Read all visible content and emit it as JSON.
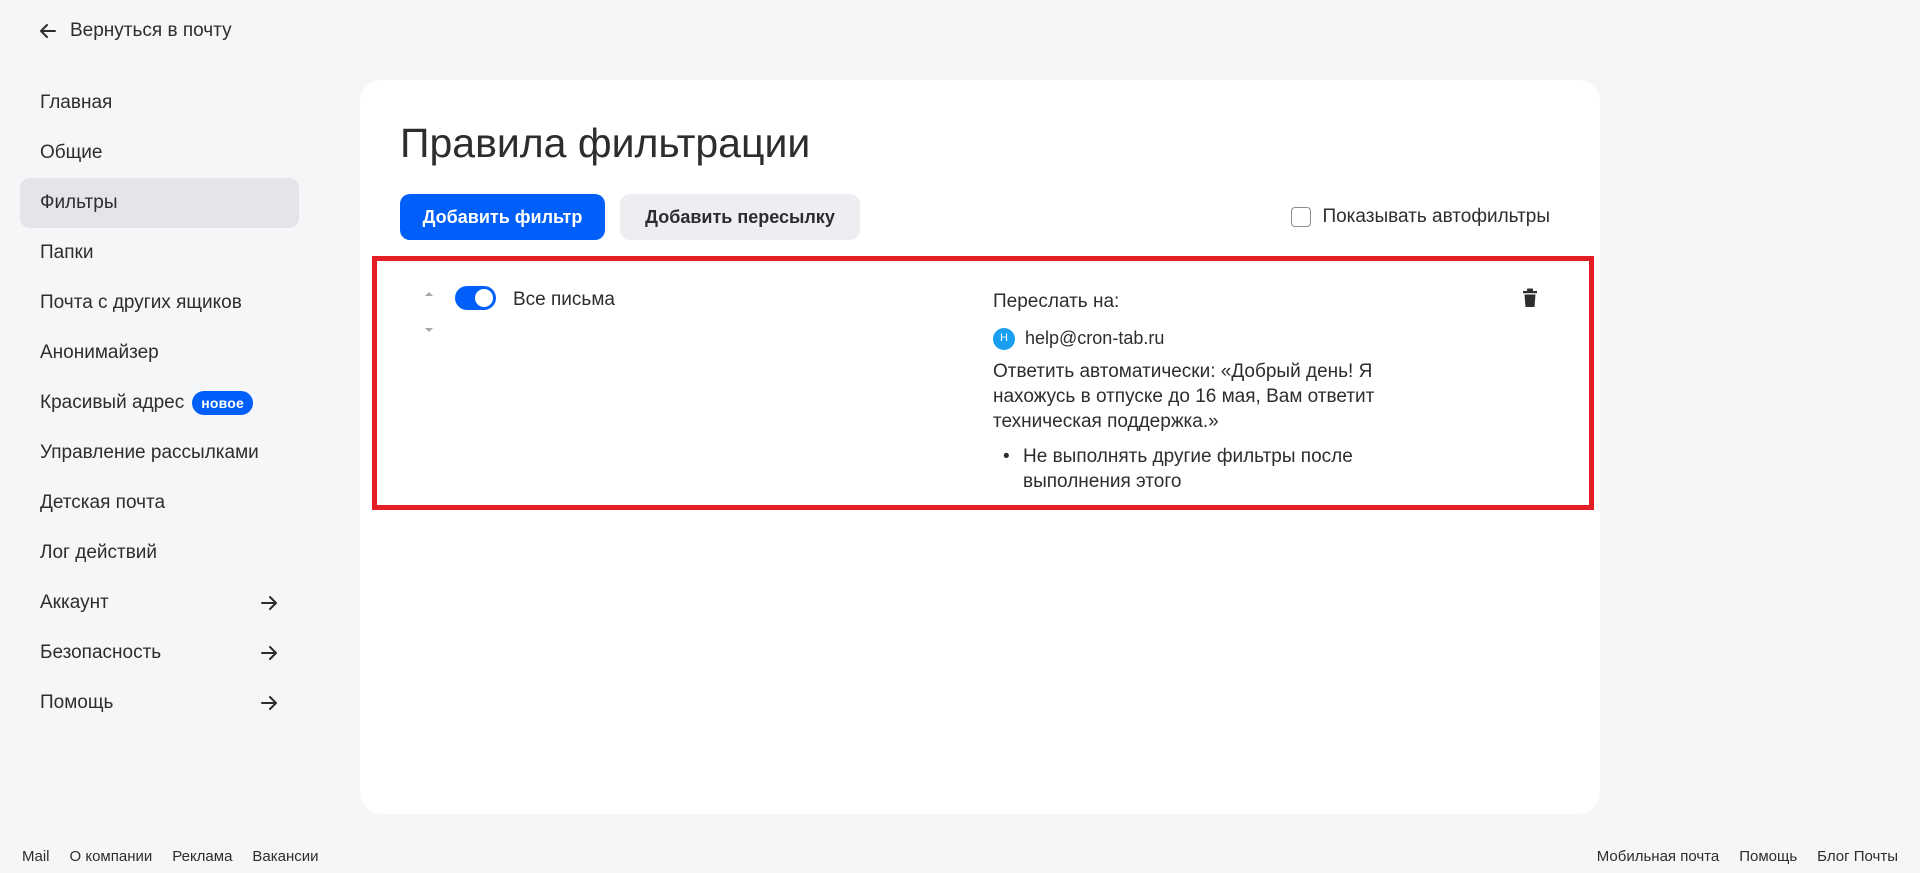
{
  "back": {
    "label": "Вернуться в почту"
  },
  "sidebar": {
    "items": [
      {
        "label": "Главная"
      },
      {
        "label": "Общие"
      },
      {
        "label": "Фильтры"
      },
      {
        "label": "Папки"
      },
      {
        "label": "Почта с других ящиков"
      },
      {
        "label": "Анонимайзер"
      },
      {
        "label": "Красивый адрес",
        "badge": "новое"
      },
      {
        "label": "Управление рассылками"
      },
      {
        "label": "Детская почта"
      },
      {
        "label": "Лог действий"
      },
      {
        "label": "Аккаунт",
        "icon": "arrow-right-icon"
      },
      {
        "label": "Безопасность",
        "icon": "arrow-right-icon"
      },
      {
        "label": "Помощь",
        "icon": "arrow-right-icon"
      }
    ],
    "active_index": 2
  },
  "main": {
    "title": "Правила фильтрации",
    "add_filter_label": "Добавить фильтр",
    "add_forward_label": "Добавить пересылку",
    "show_autofilters_label": "Показывать автофильтры",
    "show_autofilters_checked": false,
    "filter": {
      "enabled": true,
      "name": "Все письма",
      "forward_label": "Переслать на:",
      "avatar_letter": "H",
      "forward_email": "help@cron-tab.ru",
      "autoreply": "Ответить автоматически: «Добрый день! Я нахожусь в отпуске до 16 мая, Вам ответит техническая поддержка.»",
      "bullet": "Не выполнять другие фильтры после выполнения этого"
    }
  },
  "footer": {
    "left": [
      "Mail",
      "О компании",
      "Реклама",
      "Вакансии"
    ],
    "right": [
      "Мобильная почта",
      "Помощь",
      "Блог Почты"
    ]
  },
  "colors": {
    "accent": "#005ff9",
    "highlight_border": "#e31e24",
    "background": "#f5f6f8",
    "active_item": "#e4e5e8"
  }
}
